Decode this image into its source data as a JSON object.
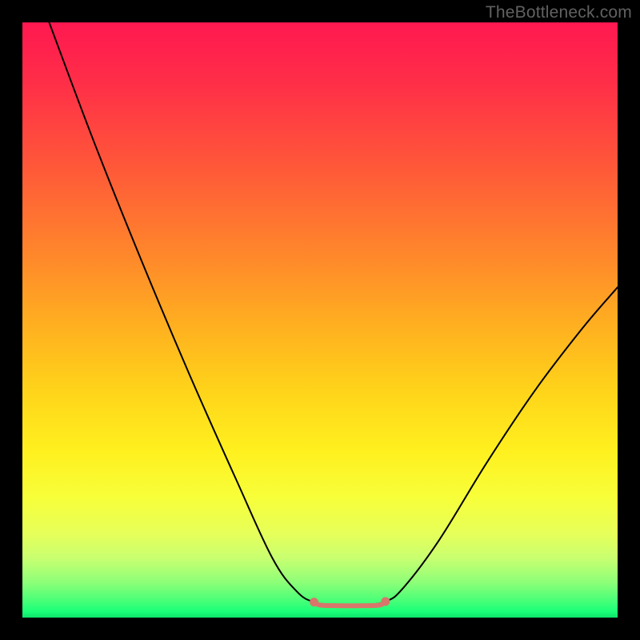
{
  "watermark": "TheBottleneck.com",
  "chart_data": {
    "type": "line",
    "title": "",
    "xlabel": "",
    "ylabel": "",
    "xlim": [
      0,
      100
    ],
    "ylim": [
      0,
      100
    ],
    "gradient_stops": [
      {
        "pos": 0.0,
        "color": "#ff1850"
      },
      {
        "pos": 0.4,
        "color": "#ff8a2a"
      },
      {
        "pos": 0.72,
        "color": "#fff01f"
      },
      {
        "pos": 0.9,
        "color": "#c8ff70"
      },
      {
        "pos": 1.0,
        "color": "#0ee26b"
      }
    ],
    "series": [
      {
        "name": "main-curve",
        "color": "#000000",
        "width": 2,
        "points": [
          {
            "x": 4.5,
            "y": 100.0
          },
          {
            "x": 12.0,
            "y": 80.0
          },
          {
            "x": 20.0,
            "y": 60.0
          },
          {
            "x": 28.0,
            "y": 41.0
          },
          {
            "x": 36.0,
            "y": 23.0
          },
          {
            "x": 42.0,
            "y": 10.0
          },
          {
            "x": 46.0,
            "y": 4.5
          },
          {
            "x": 49.0,
            "y": 2.6
          },
          {
            "x": 53.0,
            "y": 2.1
          },
          {
            "x": 57.0,
            "y": 2.1
          },
          {
            "x": 61.0,
            "y": 2.7
          },
          {
            "x": 64.0,
            "y": 5.0
          },
          {
            "x": 70.0,
            "y": 13.0
          },
          {
            "x": 78.0,
            "y": 26.0
          },
          {
            "x": 86.0,
            "y": 38.0
          },
          {
            "x": 94.0,
            "y": 48.5
          },
          {
            "x": 100.0,
            "y": 55.5
          }
        ]
      },
      {
        "name": "flat-segment",
        "color": "#d8766b",
        "width": 6,
        "points": [
          {
            "x": 49.0,
            "y": 2.6
          },
          {
            "x": 50.0,
            "y": 2.1
          },
          {
            "x": 53.0,
            "y": 2.0
          },
          {
            "x": 57.0,
            "y": 2.0
          },
          {
            "x": 60.0,
            "y": 2.1
          },
          {
            "x": 61.0,
            "y": 2.7
          }
        ],
        "endpoints": [
          {
            "x": 49.0,
            "y": 2.6
          },
          {
            "x": 61.0,
            "y": 2.7
          }
        ]
      }
    ]
  }
}
